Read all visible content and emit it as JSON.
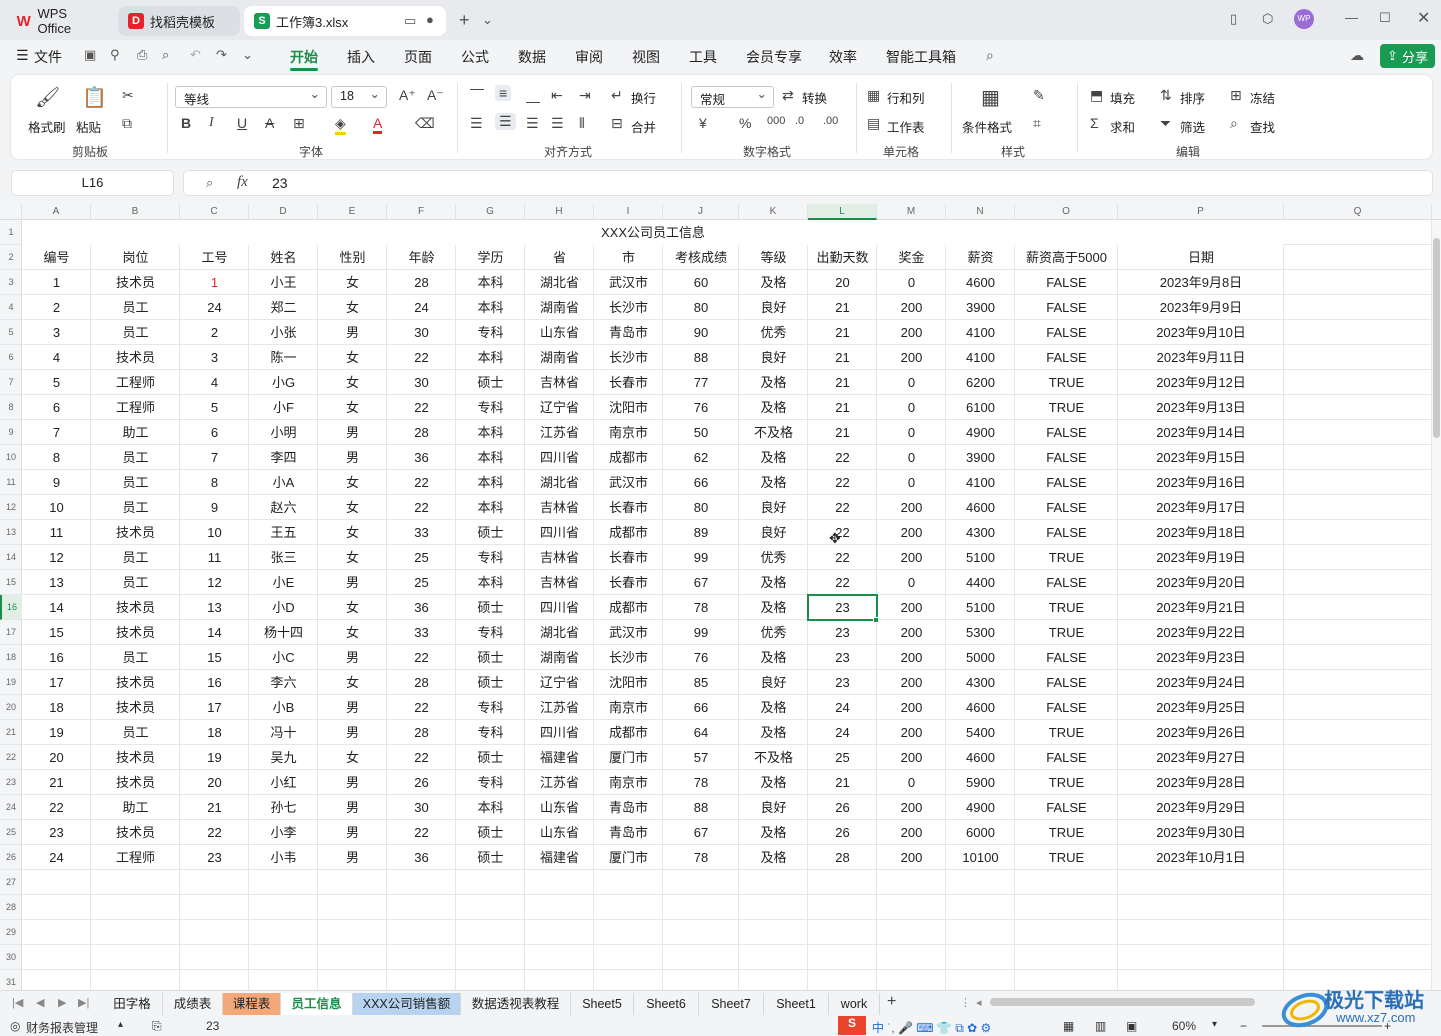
{
  "tabs": {
    "wps": "WPS Office",
    "template": "找稻壳模板",
    "file": "工作簿3.xlsx"
  },
  "menu": {
    "file": "文件",
    "items": [
      "开始",
      "插入",
      "页面",
      "公式",
      "数据",
      "审阅",
      "视图",
      "工具",
      "会员专享",
      "效率",
      "智能工具箱"
    ],
    "share": "分享"
  },
  "ribbon": {
    "format_painter": "格式刷",
    "paste": "粘贴",
    "clipboard": "剪贴板",
    "font_name": "等线",
    "font_size": "18",
    "font": "字体",
    "wrap": "换行",
    "merge": "合并",
    "alignment": "对齐方式",
    "number_format": "常规",
    "convert": "转换",
    "number": "数字格式",
    "rows_cols": "行和列",
    "worksheet": "工作表",
    "cells": "单元格",
    "cond_format": "条件格式",
    "styles": "样式",
    "fill": "填充",
    "sort": "排序",
    "freeze": "冻结",
    "sum": "求和",
    "filter": "筛选",
    "find": "查找",
    "editing": "编辑"
  },
  "formula_bar": {
    "cell_ref": "L16",
    "fx": "fx",
    "value": "23"
  },
  "columns": [
    "A",
    "B",
    "C",
    "D",
    "E",
    "F",
    "G",
    "H",
    "I",
    "J",
    "K",
    "L",
    "M",
    "N",
    "O",
    "P",
    "Q"
  ],
  "selected_column": "L",
  "selected_row": "16",
  "table": {
    "title": "XXX公司员工信息",
    "headers": [
      "编号",
      "岗位",
      "工号",
      "姓名",
      "性别",
      "年龄",
      "学历",
      "省",
      "市",
      "考核成绩",
      "等级",
      "出勤天数",
      "奖金",
      "薪资",
      "薪资高于5000",
      "日期"
    ],
    "rows": [
      [
        "1",
        "技术员",
        "1",
        "小王",
        "女",
        "28",
        "本科",
        "湖北省",
        "武汉市",
        "60",
        "及格",
        "20",
        "0",
        "4600",
        "FALSE",
        "2023年9月8日"
      ],
      [
        "2",
        "员工",
        "24",
        "郑二",
        "女",
        "24",
        "本科",
        "湖南省",
        "长沙市",
        "80",
        "良好",
        "21",
        "200",
        "3900",
        "FALSE",
        "2023年9月9日"
      ],
      [
        "3",
        "员工",
        "2",
        "小张",
        "男",
        "30",
        "专科",
        "山东省",
        "青岛市",
        "90",
        "优秀",
        "21",
        "200",
        "4100",
        "FALSE",
        "2023年9月10日"
      ],
      [
        "4",
        "技术员",
        "3",
        "陈一",
        "女",
        "22",
        "本科",
        "湖南省",
        "长沙市",
        "88",
        "良好",
        "21",
        "200",
        "4100",
        "FALSE",
        "2023年9月11日"
      ],
      [
        "5",
        "工程师",
        "4",
        "小G",
        "女",
        "30",
        "硕士",
        "吉林省",
        "长春市",
        "77",
        "及格",
        "21",
        "0",
        "6200",
        "TRUE",
        "2023年9月12日"
      ],
      [
        "6",
        "工程师",
        "5",
        "小F",
        "女",
        "22",
        "专科",
        "辽宁省",
        "沈阳市",
        "76",
        "及格",
        "21",
        "0",
        "6100",
        "TRUE",
        "2023年9月13日"
      ],
      [
        "7",
        "助工",
        "6",
        "小明",
        "男",
        "28",
        "本科",
        "江苏省",
        "南京市",
        "50",
        "不及格",
        "21",
        "0",
        "4900",
        "FALSE",
        "2023年9月14日"
      ],
      [
        "8",
        "员工",
        "7",
        "李四",
        "男",
        "36",
        "本科",
        "四川省",
        "成都市",
        "62",
        "及格",
        "22",
        "0",
        "3900",
        "FALSE",
        "2023年9月15日"
      ],
      [
        "9",
        "员工",
        "8",
        "小A",
        "女",
        "22",
        "本科",
        "湖北省",
        "武汉市",
        "66",
        "及格",
        "22",
        "0",
        "4100",
        "FALSE",
        "2023年9月16日"
      ],
      [
        "10",
        "员工",
        "9",
        "赵六",
        "女",
        "22",
        "本科",
        "吉林省",
        "长春市",
        "80",
        "良好",
        "22",
        "200",
        "4600",
        "FALSE",
        "2023年9月17日"
      ],
      [
        "11",
        "技术员",
        "10",
        "王五",
        "女",
        "33",
        "硕士",
        "四川省",
        "成都市",
        "89",
        "良好",
        "22",
        "200",
        "4300",
        "FALSE",
        "2023年9月18日"
      ],
      [
        "12",
        "员工",
        "11",
        "张三",
        "女",
        "25",
        "专科",
        "吉林省",
        "长春市",
        "99",
        "优秀",
        "22",
        "200",
        "5100",
        "TRUE",
        "2023年9月19日"
      ],
      [
        "13",
        "员工",
        "12",
        "小E",
        "男",
        "25",
        "本科",
        "吉林省",
        "长春市",
        "67",
        "及格",
        "22",
        "0",
        "4400",
        "FALSE",
        "2023年9月20日"
      ],
      [
        "14",
        "技术员",
        "13",
        "小D",
        "女",
        "36",
        "硕士",
        "四川省",
        "成都市",
        "78",
        "及格",
        "23",
        "200",
        "5100",
        "TRUE",
        "2023年9月21日"
      ],
      [
        "15",
        "技术员",
        "14",
        "杨十四",
        "女",
        "33",
        "专科",
        "湖北省",
        "武汉市",
        "99",
        "优秀",
        "23",
        "200",
        "5300",
        "TRUE",
        "2023年9月22日"
      ],
      [
        "16",
        "员工",
        "15",
        "小C",
        "男",
        "22",
        "硕士",
        "湖南省",
        "长沙市",
        "76",
        "及格",
        "23",
        "200",
        "5000",
        "FALSE",
        "2023年9月23日"
      ],
      [
        "17",
        "技术员",
        "16",
        "李六",
        "女",
        "28",
        "硕士",
        "辽宁省",
        "沈阳市",
        "85",
        "良好",
        "23",
        "200",
        "4300",
        "FALSE",
        "2023年9月24日"
      ],
      [
        "18",
        "技术员",
        "17",
        "小B",
        "男",
        "22",
        "专科",
        "江苏省",
        "南京市",
        "66",
        "及格",
        "24",
        "200",
        "4600",
        "FALSE",
        "2023年9月25日"
      ],
      [
        "19",
        "员工",
        "18",
        "冯十",
        "男",
        "28",
        "专科",
        "四川省",
        "成都市",
        "64",
        "及格",
        "24",
        "200",
        "5400",
        "TRUE",
        "2023年9月26日"
      ],
      [
        "20",
        "技术员",
        "19",
        "吴九",
        "女",
        "22",
        "硕士",
        "福建省",
        "厦门市",
        "57",
        "不及格",
        "25",
        "200",
        "4600",
        "FALSE",
        "2023年9月27日"
      ],
      [
        "21",
        "技术员",
        "20",
        "小红",
        "男",
        "26",
        "专科",
        "江苏省",
        "南京市",
        "78",
        "及格",
        "21",
        "0",
        "5900",
        "TRUE",
        "2023年9月28日"
      ],
      [
        "22",
        "助工",
        "21",
        "孙七",
        "男",
        "30",
        "本科",
        "山东省",
        "青岛市",
        "88",
        "良好",
        "26",
        "200",
        "4900",
        "FALSE",
        "2023年9月29日"
      ],
      [
        "23",
        "技术员",
        "22",
        "小李",
        "男",
        "22",
        "硕士",
        "山东省",
        "青岛市",
        "67",
        "及格",
        "26",
        "200",
        "6000",
        "TRUE",
        "2023年9月30日"
      ],
      [
        "24",
        "工程师",
        "23",
        "小韦",
        "男",
        "36",
        "硕士",
        "福建省",
        "厦门市",
        "78",
        "及格",
        "28",
        "200",
        "10100",
        "TRUE",
        "2023年10月1日"
      ]
    ]
  },
  "sheets": [
    "田字格",
    "成绩表",
    "课程表",
    "员工信息",
    "XXX公司销售额",
    "数据透视表教程",
    "Sheet5",
    "Sheet6",
    "Sheet7",
    "Sheet1",
    "work"
  ],
  "status": {
    "left": "财务报表管理",
    "value": "23",
    "zoom": "60%"
  },
  "watermark": {
    "name": "极光下载站",
    "url": "www.xz7.com"
  },
  "colors": {
    "accent": "#1a8f4a",
    "red_text": "#e0262a",
    "tab_orange": "#f4a779",
    "tab_blue": "#b7d3ef"
  }
}
